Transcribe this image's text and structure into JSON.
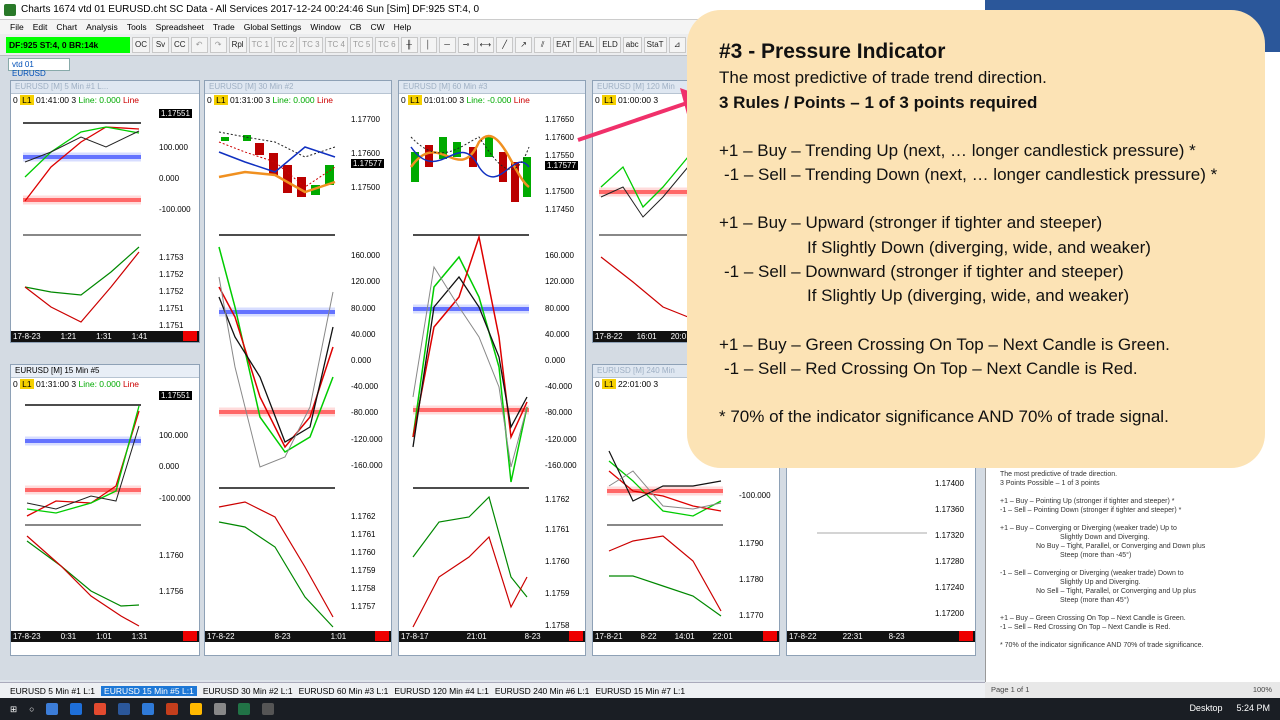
{
  "app": {
    "title": "Charts 1674 vtd 01 EURUSD.cht  SC Data - All Services 2017-12-24  00:24:46 Sun [Sim]  DF:925  ST:4, 0",
    "menu": [
      "File",
      "Edit",
      "Chart",
      "Analysis",
      "Tools",
      "Spreadsheet",
      "Trade",
      "Global Settings",
      "Window",
      "CB",
      "CW",
      "Help"
    ],
    "status_green": "DF:925  ST:4, 0  BR:14k",
    "toolbar": [
      "OC",
      "Sv",
      "CC",
      "Rpl",
      "TC 1",
      "TC 2",
      "TC 3",
      "TC 4",
      "TC 5",
      "TC 6",
      "EAT",
      "EAL",
      "ELD",
      "abc",
      "StaT"
    ],
    "chartbook_tab": "vtd 01 EURUSD"
  },
  "windows": [
    {
      "title": "EURUSD [M]  5 Min  #1  L...",
      "info_time": "01:41:00 3",
      "info_line": "Line: 0.000",
      "price_tag": "1.17551",
      "ticks_top": [
        "100.000",
        "0.000",
        "-100.000"
      ],
      "ticks_bot": [
        "1.1753",
        "1.1752",
        "1.1752",
        "1.1751",
        "1.1751"
      ],
      "xaxis": [
        "17-8-23",
        "1:21",
        "1:31",
        "1:41"
      ]
    },
    {
      "title": "EURUSD [M]  30 Min  #2",
      "info_time": "01:31:00 3",
      "info_line": "Line: 0.000",
      "price_tag": "1.17577",
      "ticks_top": [
        "1.17700",
        "1.17600",
        "1.17500"
      ],
      "ticks_mid": [
        "160.000",
        "120.000",
        "80.000",
        "40.000",
        "0.000",
        "-40.000",
        "-80.000",
        "-120.000",
        "-160.000"
      ],
      "ticks_bot": [
        "1.1762",
        "1.1761",
        "1.1760",
        "1.1759",
        "1.1758",
        "1.1757"
      ],
      "xaxis": [
        "17-8-22",
        "8-23",
        "1:01"
      ]
    },
    {
      "title": "EURUSD [M]  60 Min  #3",
      "info_time": "01:01:00 3",
      "info_line": "Line: -0.000",
      "price_tag": "1.17577",
      "ticks_top": [
        "1.17650",
        "1.17600",
        "1.17550",
        "1.17500",
        "1.17450"
      ],
      "ticks_mid": [
        "160.000",
        "120.000",
        "80.000",
        "40.000",
        "0.000",
        "-40.000",
        "-80.000",
        "-120.000",
        "-160.000"
      ],
      "ticks_bot": [
        "1.1762",
        "1.1761",
        "1.1760",
        "1.1759",
        "1.1758"
      ],
      "xaxis": [
        "17-8-17",
        "21:01",
        "8-23"
      ]
    },
    {
      "title": "EURUSD [M]  120 Min",
      "info_time": "01:00:00 3",
      "xaxis": [
        "17-8-22",
        "16:01",
        "20:0"
      ]
    },
    {
      "title": "EURUSD [M]  15 Min  #5",
      "info_time": "01:31:00 3",
      "info_line": "Line: 0.000",
      "price_tag": "1.17551",
      "ticks_top": [
        "100.000",
        "0.000",
        "-100.000"
      ],
      "ticks_bot": [
        "1.1760",
        "1.1756"
      ],
      "xaxis": [
        "17-8-23",
        "0:31",
        "1:01",
        "1:31"
      ]
    },
    {
      "title": "EURUSD [M]  240 Min",
      "info_time": "22:01:00 3",
      "ticks_top": [
        "-100.000"
      ],
      "ticks_bot": [
        "1.1790",
        "1.1780",
        "1.1770"
      ],
      "xaxis": [
        "17-8-21",
        "8-22",
        "14:01",
        "22:01"
      ]
    },
    {
      "title": "",
      "ticks_bot": [
        "1.17400",
        "1.17360",
        "1.17320",
        "1.17280",
        "1.17240",
        "1.17200"
      ],
      "xaxis": [
        "17-8-22",
        "22:31",
        "8-23"
      ]
    }
  ],
  "bottom_tabs": [
    "EURUSD  5 Min  #1  L:1",
    "EURUSD  15 Min  #5  L:1",
    "EURUSD  30 Min  #2  L:1",
    "EURUSD  60 Min  #3  L:1",
    "EURUSD  120 Min  #4  L:1",
    "EURUSD  240 Min  #6  L:1",
    "EURUSD  15 Min  #7  L:1"
  ],
  "callout": {
    "heading": "#3 - Pressure Indicator",
    "subtitle": "The most predictive of trade trend direction.",
    "rules": "3 Rules / Points – 1 of 3 points required",
    "l1": "+1 – Buy – Trending Up (next, … longer candlestick pressure) *",
    "l2": "-1 – Sell – Trending Down (next, … longer candlestick pressure) *",
    "l3": "+1 – Buy – Upward (stronger if tighter and steeper)",
    "l4": "If Slightly Down (diverging, wide, and weaker)",
    "l5": "-1 – Sell – Downward (stronger if tighter and steeper)",
    "l6": "If Slightly Up (diverging, wide, and weaker)",
    "l7": "+1 – Buy – Green Crossing On Top – Next Candle is Green.",
    "l8": "-1 – Sell – Red Crossing On Top – Next Candle is Red.",
    "l9": "* 70% of the indicator significance AND 70% of trade signal."
  },
  "doc": {
    "lines": [
      "The most predictive of trade direction.",
      "3 Points Possible – 1 of 3 points",
      "+1 – Buy – Pointing Up (stronger if tighter and steeper) *",
      "-1 – Sell – Pointing Down (stronger if tighter and steeper) *",
      "+1 – Buy – Converging or Diverging (weaker trade) Up to",
      "Slightly Down and Diverging.",
      "No Buy – Tight, Parallel, or Converging and Down plus",
      "Steep (more than -45°)",
      "-1 – Sell – Converging or Diverging (weaker trade) Down to",
      "Slightly Up and Diverging.",
      "No Sell – Tight, Parallel, or Converging and Up plus",
      "Steep (more than 45°)",
      "+1 – Buy – Green Crossing On Top – Next Candle is Green.",
      "-1 – Sell – Red Crossing On Top – Next Candle is Red.",
      "* 70% of the indicator significance AND 70% of trade significance."
    ],
    "status": "Page 1 of 1",
    "zoom": "100%"
  },
  "taskbar": {
    "desktop": "Desktop",
    "time": "5:24 PM"
  }
}
